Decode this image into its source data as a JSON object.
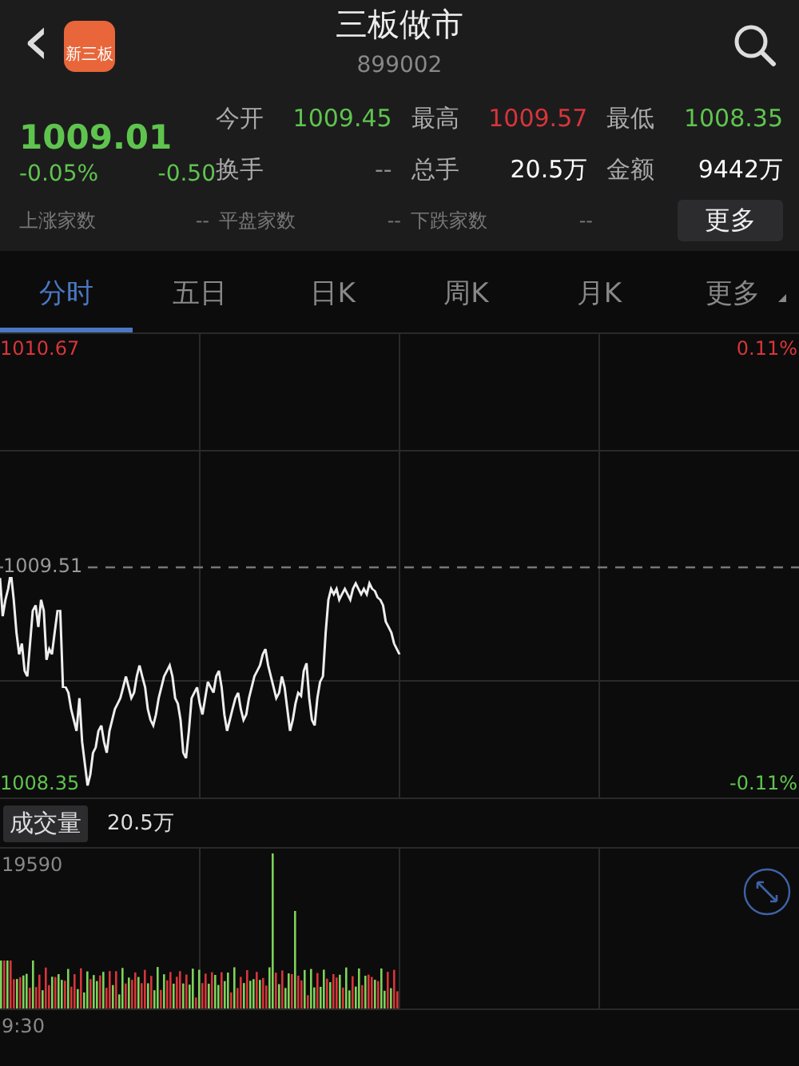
{
  "header": {
    "back": "‹",
    "logo_text": "新三板",
    "title": "三板做市",
    "code": "899002"
  },
  "quote": {
    "price": "1009.01",
    "change_pct": "-0.05%",
    "change": "-0.50",
    "color": "#5fc44e"
  },
  "stat_rows": [
    {
      "items": [
        {
          "label": "今开",
          "value": "1009.45",
          "color": "#5fc44e"
        },
        {
          "label": "最高",
          "value": "1009.57",
          "color": "#d8353a"
        },
        {
          "label": "最低",
          "value": "1008.35",
          "color": "#5fc44e"
        }
      ]
    },
    {
      "items": [
        {
          "label": "换手",
          "value": "--",
          "color": "#8a8a8a"
        },
        {
          "label": "总手",
          "value": "20.5万",
          "color": "#ffffff"
        },
        {
          "label": "金额",
          "value": "9442万",
          "color": "#ffffff"
        }
      ]
    }
  ],
  "breadth": [
    {
      "label": "上涨家数",
      "value": "--"
    },
    {
      "label": "平盘家数",
      "value": "--"
    },
    {
      "label": "下跌家数",
      "value": "--"
    }
  ],
  "more_button": "更多",
  "tabs": [
    {
      "label": "分时",
      "selected": true
    },
    {
      "label": "五日",
      "selected": false
    },
    {
      "label": "日K",
      "selected": false
    },
    {
      "label": "周K",
      "selected": false
    },
    {
      "label": "月K",
      "selected": false
    },
    {
      "label": "更多",
      "selected": false
    }
  ],
  "price_chart": {
    "high": "1010.67",
    "high_pct": "0.11%",
    "prev_close": "1009.51",
    "low": "1008.35",
    "low_pct": "-0.11%"
  },
  "volume": {
    "label": "成交量",
    "total": "20.5万",
    "max": "19590",
    "start_time": "9:30"
  }
}
